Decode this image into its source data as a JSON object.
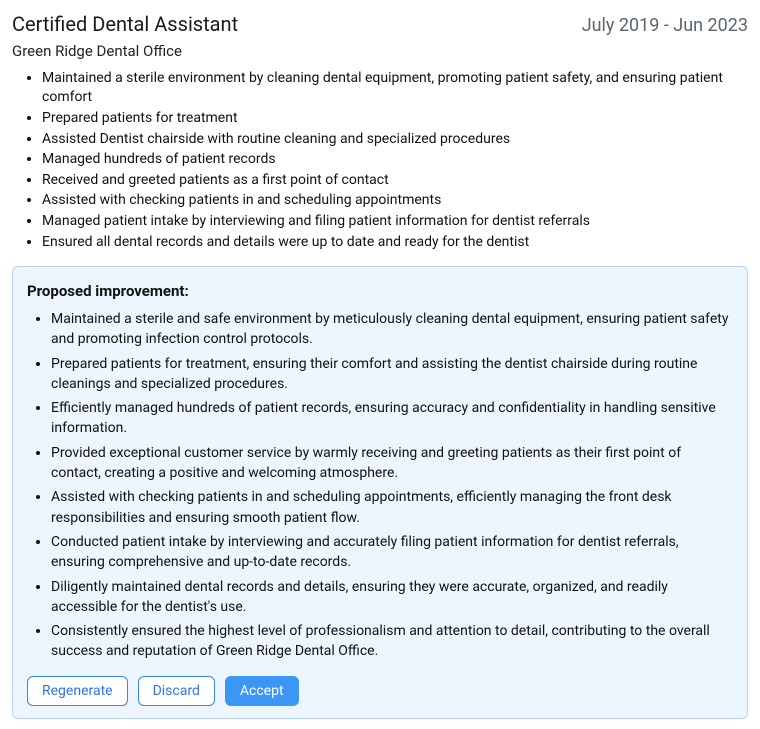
{
  "header": {
    "title": "Certified Dental Assistant",
    "dates": "July 2019 - Jun 2023",
    "company": "Green Ridge Dental Office"
  },
  "current_bullets": [
    "Maintained a sterile environment by cleaning dental equipment, promoting patient safety, and ensuring patient comfort",
    "Prepared patients for treatment",
    "Assisted Dentist chairside with routine cleaning and specialized procedures",
    "Managed hundreds of patient records",
    "Received and greeted patients as a first point of contact",
    "Assisted with checking patients in and scheduling appointments",
    "Managed patient intake by interviewing and filing patient information for dentist referrals",
    "Ensured all dental records and details were up to date and ready for the dentist"
  ],
  "proposal": {
    "heading": "Proposed improvement:",
    "bullets": [
      "Maintained a sterile and safe environment by meticulously cleaning dental equipment, ensuring patient safety and promoting infection control protocols.",
      "Prepared patients for treatment, ensuring their comfort and assisting the dentist chairside during routine cleanings and specialized procedures.",
      "Efficiently managed hundreds of patient records, ensuring accuracy and confidentiality in handling sensitive information.",
      "Provided exceptional customer service by warmly receiving and greeting patients as their first point of contact, creating a positive and welcoming atmosphere.",
      "Assisted with checking patients in and scheduling appointments, efficiently managing the front desk responsibilities and ensuring smooth patient flow.",
      "Conducted patient intake by interviewing and accurately filing patient information for dentist referrals, ensuring comprehensive and up-to-date records.",
      "Diligently maintained dental records and details, ensuring they were accurate, organized, and readily accessible for the dentist's use.",
      "Consistently ensured the highest level of professionalism and attention to detail, contributing to the overall success and reputation of Green Ridge Dental Office."
    ]
  },
  "buttons": {
    "regenerate": "Regenerate",
    "discard": "Discard",
    "accept": "Accept"
  }
}
